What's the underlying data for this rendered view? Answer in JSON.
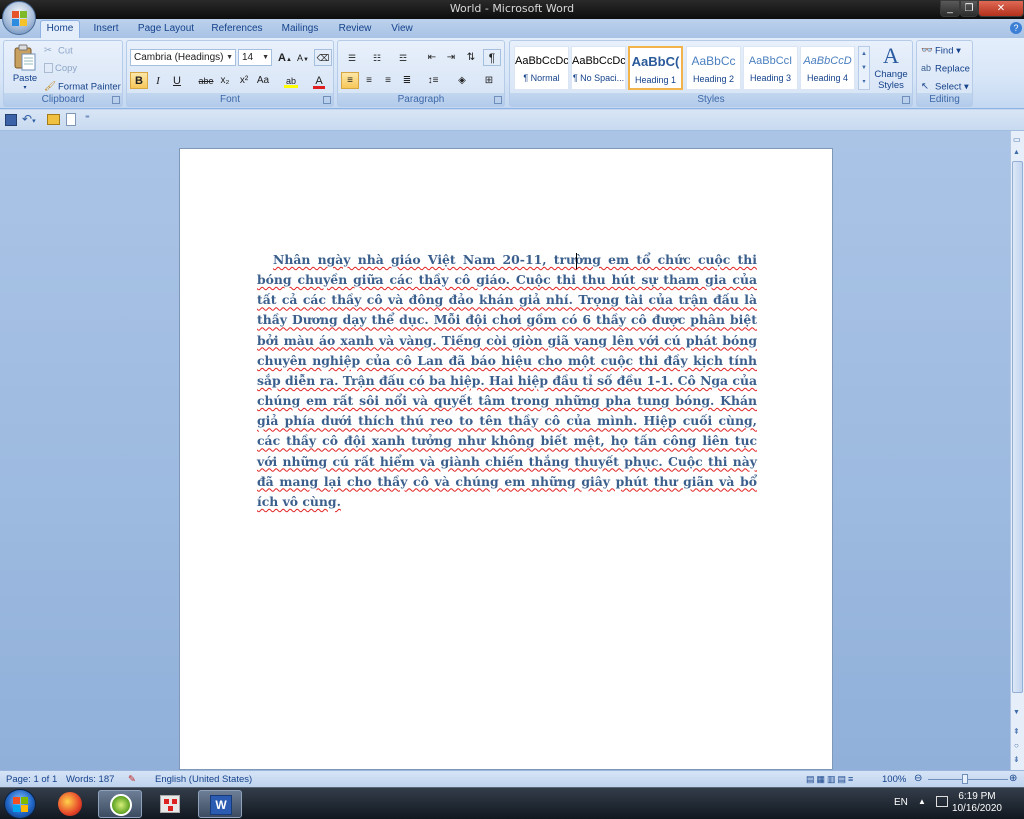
{
  "window": {
    "title": "World - Microsoft Word",
    "minimize": "_",
    "restore": "❐",
    "close": "✕"
  },
  "tabs": [
    {
      "label": "Home",
      "active": true
    },
    {
      "label": "Insert"
    },
    {
      "label": "Page Layout"
    },
    {
      "label": "References"
    },
    {
      "label": "Mailings"
    },
    {
      "label": "Review"
    },
    {
      "label": "View"
    }
  ],
  "clipboard": {
    "paste": "Paste",
    "cut": "Cut",
    "copy": "Copy",
    "format_painter": "Format Painter",
    "label": "Clipboard"
  },
  "font": {
    "name": "Cambria (Headings)",
    "size": "14",
    "label": "Font",
    "bold": "B",
    "italic": "I",
    "underline": "U",
    "strike": "abe",
    "sub": "x₂",
    "sup": "x²",
    "case": "Aa",
    "grow": "A",
    "shrink": "A"
  },
  "paragraph": {
    "label": "Paragraph"
  },
  "styles": {
    "label": "Styles",
    "items": [
      {
        "sample": "AaBbCcDc",
        "name": "¶ Normal"
      },
      {
        "sample": "AaBbCcDc",
        "name": "¶ No Spaci..."
      },
      {
        "sample": "AaBbC(",
        "name": "Heading 1"
      },
      {
        "sample": "AaBbCc",
        "name": "Heading 2"
      },
      {
        "sample": "AaBbCcI",
        "name": "Heading 3"
      },
      {
        "sample": "AaBbCcD",
        "name": "Heading 4"
      }
    ],
    "change_styles": "Change Styles"
  },
  "editing": {
    "label": "Editing",
    "find": "Find",
    "replace": "Replace",
    "select": "Select"
  },
  "document": {
    "text": "Nhân ngày nhà giáo Việt Nam 20-11, trường em tổ chức cuộc thi bóng chuyền giữa các thầy cô giáo. Cuộc thi thu hút sự tham gia của tất cả các thầy cô và đông đảo khán giả nhí. Trọng tài của trận đấu là thầy Dương dạy thể dục. Mỗi đội chơi gồm có 6 thầy cô được phân biệt bởi màu áo xanh và vàng. Tiếng còi giòn giã vang lên với cú phát bóng chuyên nghiệp của cô Lan đã báo hiệu cho một cuộc thi đầy kịch tính sắp diễn ra. Trận đấu có ba hiệp. Hai hiệp đầu tỉ số đều 1-1. Cô Nga của chúng em rất sôi nổi và quyết tâm trong những pha tung bóng. Khán giả phía dưới thích thú reo to tên thầy cô của mình. Hiệp cuối cùng, các thầy cô đội xanh tưởng như không biết mệt, họ tấn công liên tục với những cú rất hiểm và giành chiến thắng thuyết phục. Cuộc thi này đã mang lại cho thầy cô và chúng em những giây phút thư giãn và bổ ích vô cùng."
  },
  "status": {
    "page": "Page: 1 of 1",
    "words": "Words: 187",
    "language": "English (United States)",
    "zoom": "100%"
  },
  "taskbar": {
    "lang": "EN",
    "time": "6:19 PM",
    "date": "10/16/2020"
  }
}
